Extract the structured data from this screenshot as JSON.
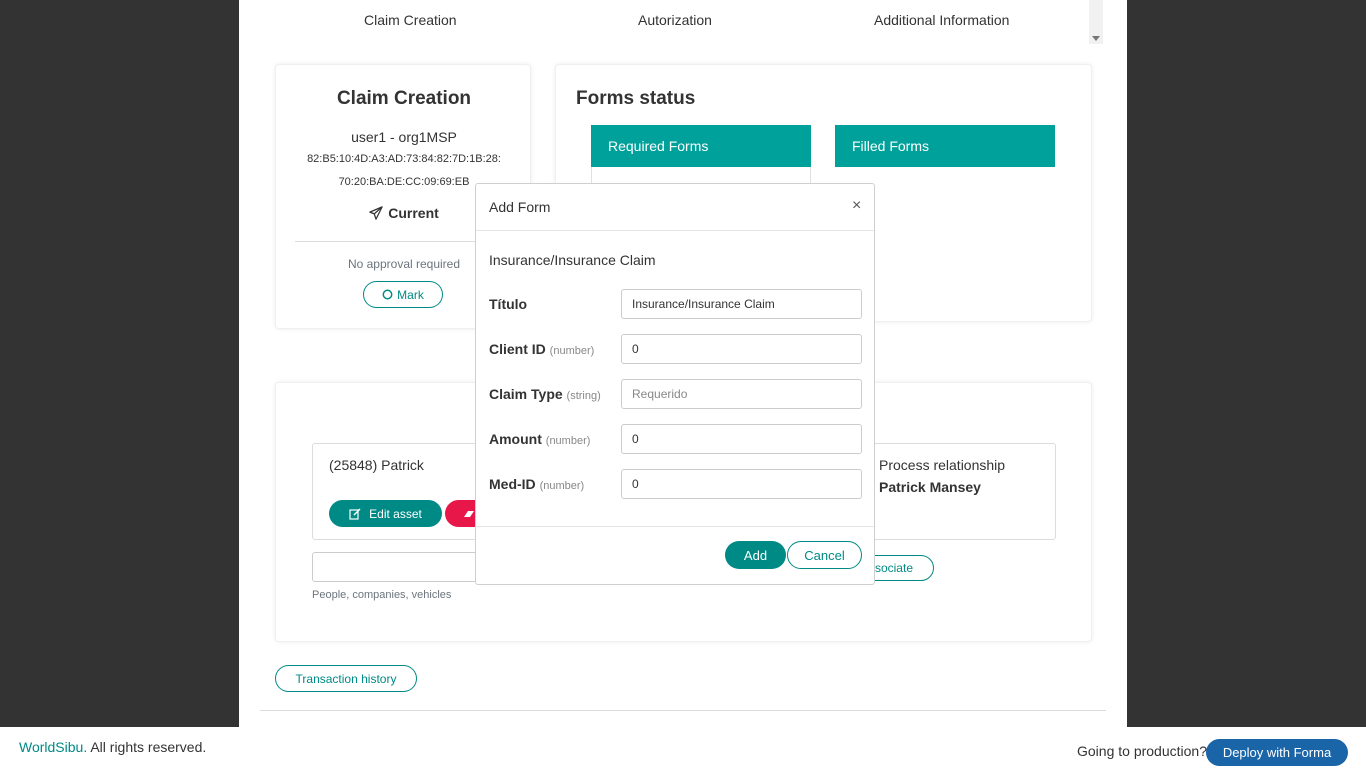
{
  "steps": [
    "Claim Creation",
    "Autorization",
    "Additional Information"
  ],
  "claim_card": {
    "title": "Claim Creation",
    "user": "user1 - org1MSP",
    "fingerprint_line1": "82:B5:10:4D:A3:AD:73:84:82:7D:1B:28:",
    "fingerprint_line2": "70:20:BA:DE:CC:09:69:EB",
    "status_icon": "paper-plane-icon",
    "status": "Current",
    "approval": "No approval required",
    "mark_icon": "circle-icon",
    "mark_label": "Mark"
  },
  "forms_status": {
    "title": "Forms status",
    "required_label": "Required Forms",
    "filled_label": "Filled Forms"
  },
  "asset_card": {
    "asset_name": "(25848) Patrick",
    "edit_icon": "edit-icon",
    "edit_label": "Edit asset",
    "delete_icon": "eraser-icon",
    "relationship_label": "Process relationship",
    "relationship_name": "Patrick Mansey",
    "search_hint": "People, companies, vehicles",
    "associate_label": "sociate"
  },
  "transaction_history_label": "Transaction history",
  "modal": {
    "title": "Add Form",
    "close_icon": "close-icon",
    "close_glyph": "×",
    "subtitle": "Insurance/Insurance Claim",
    "fields": [
      {
        "label": "Título",
        "type": "",
        "value": "Insurance/Insurance Claim",
        "placeholder": ""
      },
      {
        "label": "Client ID",
        "type": "(number)",
        "value": "0",
        "placeholder": ""
      },
      {
        "label": "Claim Type",
        "type": "(string)",
        "value": "",
        "placeholder": "Requerido"
      },
      {
        "label": "Amount",
        "type": "(number)",
        "value": "0",
        "placeholder": ""
      },
      {
        "label": "Med-ID",
        "type": "(number)",
        "value": "0",
        "placeholder": ""
      }
    ],
    "add_label": "Add",
    "cancel_label": "Cancel"
  },
  "footer": {
    "brand": "WorldSibu.",
    "rights": " All rights reserved.",
    "prod_question": "Going to production?",
    "deploy_label": "Deploy with Forma"
  },
  "colors": {
    "teal": "#00a19a",
    "teal_dark": "#008a85",
    "danger": "#e8174a",
    "backdrop": "#333333",
    "deploy": "#1a64a8"
  }
}
